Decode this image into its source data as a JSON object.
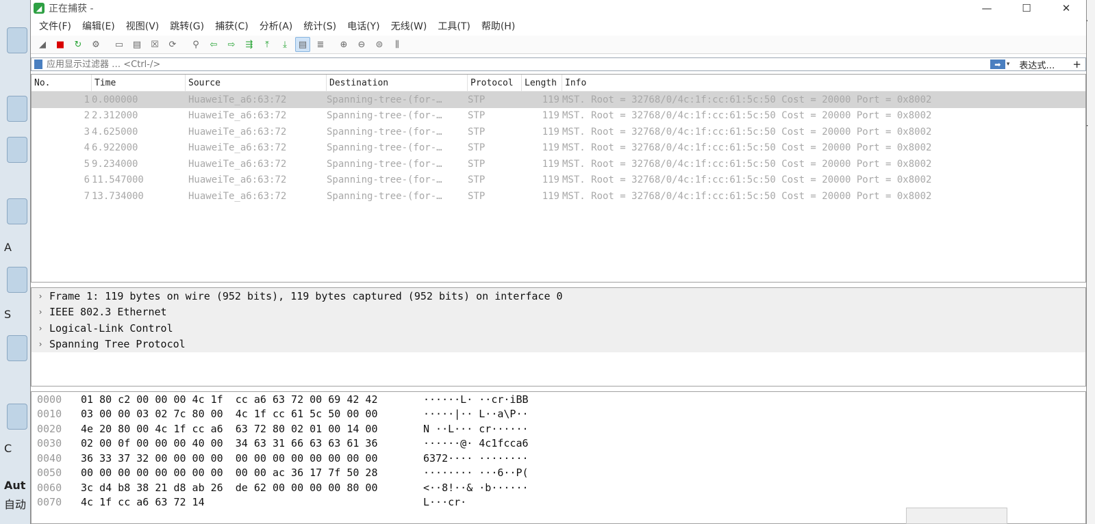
{
  "background_app": {
    "left_labels": [
      "A",
      "S",
      "C",
      "Aut",
      "自动"
    ],
    "right_labels": [
      "息",
      "計"
    ]
  },
  "window": {
    "title": "正在捕获 -",
    "minimize_glyph": "—",
    "maximize_glyph": "☐",
    "close_glyph": "✕"
  },
  "menu": [
    "文件(F)",
    "编辑(E)",
    "视图(V)",
    "跳转(G)",
    "捕获(C)",
    "分析(A)",
    "统计(S)",
    "电话(Y)",
    "无线(W)",
    "工具(T)",
    "帮助(H)"
  ],
  "toolbar": [
    {
      "icon": "shark-fin-start-icon",
      "glyph": "◢"
    },
    {
      "icon": "stop-capture-icon",
      "glyph": "■"
    },
    {
      "icon": "restart-capture-icon",
      "glyph": "↻"
    },
    {
      "icon": "capture-options-icon",
      "glyph": "⚙"
    },
    {
      "icon": "open-file-icon",
      "glyph": "▭"
    },
    {
      "icon": "save-file-icon",
      "glyph": "▤"
    },
    {
      "icon": "close-file-icon",
      "glyph": "☒"
    },
    {
      "icon": "reload-file-icon",
      "glyph": "⟳"
    },
    {
      "icon": "find-packet-icon",
      "glyph": "⚲"
    },
    {
      "icon": "go-back-icon",
      "glyph": "⇦"
    },
    {
      "icon": "go-forward-icon",
      "glyph": "⇨"
    },
    {
      "icon": "go-to-packet-icon",
      "glyph": "⇶"
    },
    {
      "icon": "go-first-packet-icon",
      "glyph": "⤒"
    },
    {
      "icon": "go-last-packet-icon",
      "glyph": "⤓"
    },
    {
      "icon": "auto-scroll-icon",
      "glyph": "▤"
    },
    {
      "icon": "colorize-icon",
      "glyph": "≣"
    },
    {
      "icon": "zoom-in-icon",
      "glyph": "⊕"
    },
    {
      "icon": "zoom-out-icon",
      "glyph": "⊖"
    },
    {
      "icon": "zoom-normal-icon",
      "glyph": "⊜"
    },
    {
      "icon": "resize-columns-icon",
      "glyph": "⫼"
    }
  ],
  "filter": {
    "placeholder": "应用显示过滤器 … <Ctrl-/>",
    "apply_glyph": "➡",
    "dropdown_glyph": "▾",
    "expression_label": "表达式…",
    "add_glyph": "+"
  },
  "packet_list": {
    "columns": [
      "No.",
      "Time",
      "Source",
      "Destination",
      "Protocol",
      "Length",
      "Info"
    ],
    "rows": [
      {
        "no": "1",
        "time": "0.000000",
        "source": "HuaweiTe_a6:63:72",
        "destination": "Spanning-tree-(for-…",
        "protocol": "STP",
        "length": "119",
        "info": "MST. Root = 32768/0/4c:1f:cc:61:5c:50  Cost = 20000  Port = 0x8002"
      },
      {
        "no": "2",
        "time": "2.312000",
        "source": "HuaweiTe_a6:63:72",
        "destination": "Spanning-tree-(for-…",
        "protocol": "STP",
        "length": "119",
        "info": "MST. Root = 32768/0/4c:1f:cc:61:5c:50  Cost = 20000  Port = 0x8002"
      },
      {
        "no": "3",
        "time": "4.625000",
        "source": "HuaweiTe_a6:63:72",
        "destination": "Spanning-tree-(for-…",
        "protocol": "STP",
        "length": "119",
        "info": "MST. Root = 32768/0/4c:1f:cc:61:5c:50  Cost = 20000  Port = 0x8002"
      },
      {
        "no": "4",
        "time": "6.922000",
        "source": "HuaweiTe_a6:63:72",
        "destination": "Spanning-tree-(for-…",
        "protocol": "STP",
        "length": "119",
        "info": "MST. Root = 32768/0/4c:1f:cc:61:5c:50  Cost = 20000  Port = 0x8002"
      },
      {
        "no": "5",
        "time": "9.234000",
        "source": "HuaweiTe_a6:63:72",
        "destination": "Spanning-tree-(for-…",
        "protocol": "STP",
        "length": "119",
        "info": "MST. Root = 32768/0/4c:1f:cc:61:5c:50  Cost = 20000  Port = 0x8002"
      },
      {
        "no": "6",
        "time": "11.547000",
        "source": "HuaweiTe_a6:63:72",
        "destination": "Spanning-tree-(for-…",
        "protocol": "STP",
        "length": "119",
        "info": "MST. Root = 32768/0/4c:1f:cc:61:5c:50  Cost = 20000  Port = 0x8002"
      },
      {
        "no": "7",
        "time": "13.734000",
        "source": "HuaweiTe_a6:63:72",
        "destination": "Spanning-tree-(for-…",
        "protocol": "STP",
        "length": "119",
        "info": "MST. Root = 32768/0/4c:1f:cc:61:5c:50  Cost = 20000  Port = 0x8002"
      }
    ]
  },
  "details": [
    "Frame 1: 119 bytes on wire (952 bits), 119 bytes captured (952 bits) on interface 0",
    "IEEE 802.3 Ethernet",
    "Logical-Link Control",
    "Spanning Tree Protocol"
  ],
  "bytes": [
    {
      "offset": "0000",
      "hex": "01 80 c2 00 00 00 4c 1f  cc a6 63 72 00 69 42 42",
      "ascii": "······L· ··cr·iBB"
    },
    {
      "offset": "0010",
      "hex": "03 00 00 03 02 7c 80 00  4c 1f cc 61 5c 50 00 00",
      "ascii": "·····|·· L··a\\P··"
    },
    {
      "offset": "0020",
      "hex": "4e 20 80 00 4c 1f cc a6  63 72 80 02 01 00 14 00",
      "ascii": "N ··L··· cr······"
    },
    {
      "offset": "0030",
      "hex": "02 00 0f 00 00 00 40 00  34 63 31 66 63 63 61 36",
      "ascii": "······@· 4c1fcca6"
    },
    {
      "offset": "0040",
      "hex": "36 33 37 32 00 00 00 00  00 00 00 00 00 00 00 00",
      "ascii": "6372···· ········"
    },
    {
      "offset": "0050",
      "hex": "00 00 00 00 00 00 00 00  00 00 ac 36 17 7f 50 28",
      "ascii": "········ ···6··P("
    },
    {
      "offset": "0060",
      "hex": "3c d4 b8 38 21 d8 ab 26  de 62 00 00 00 00 80 00",
      "ascii": "<··8!··& ·b······"
    },
    {
      "offset": "0070",
      "hex": "4c 1f cc a6 63 72 14",
      "ascii": "L···cr·"
    }
  ]
}
